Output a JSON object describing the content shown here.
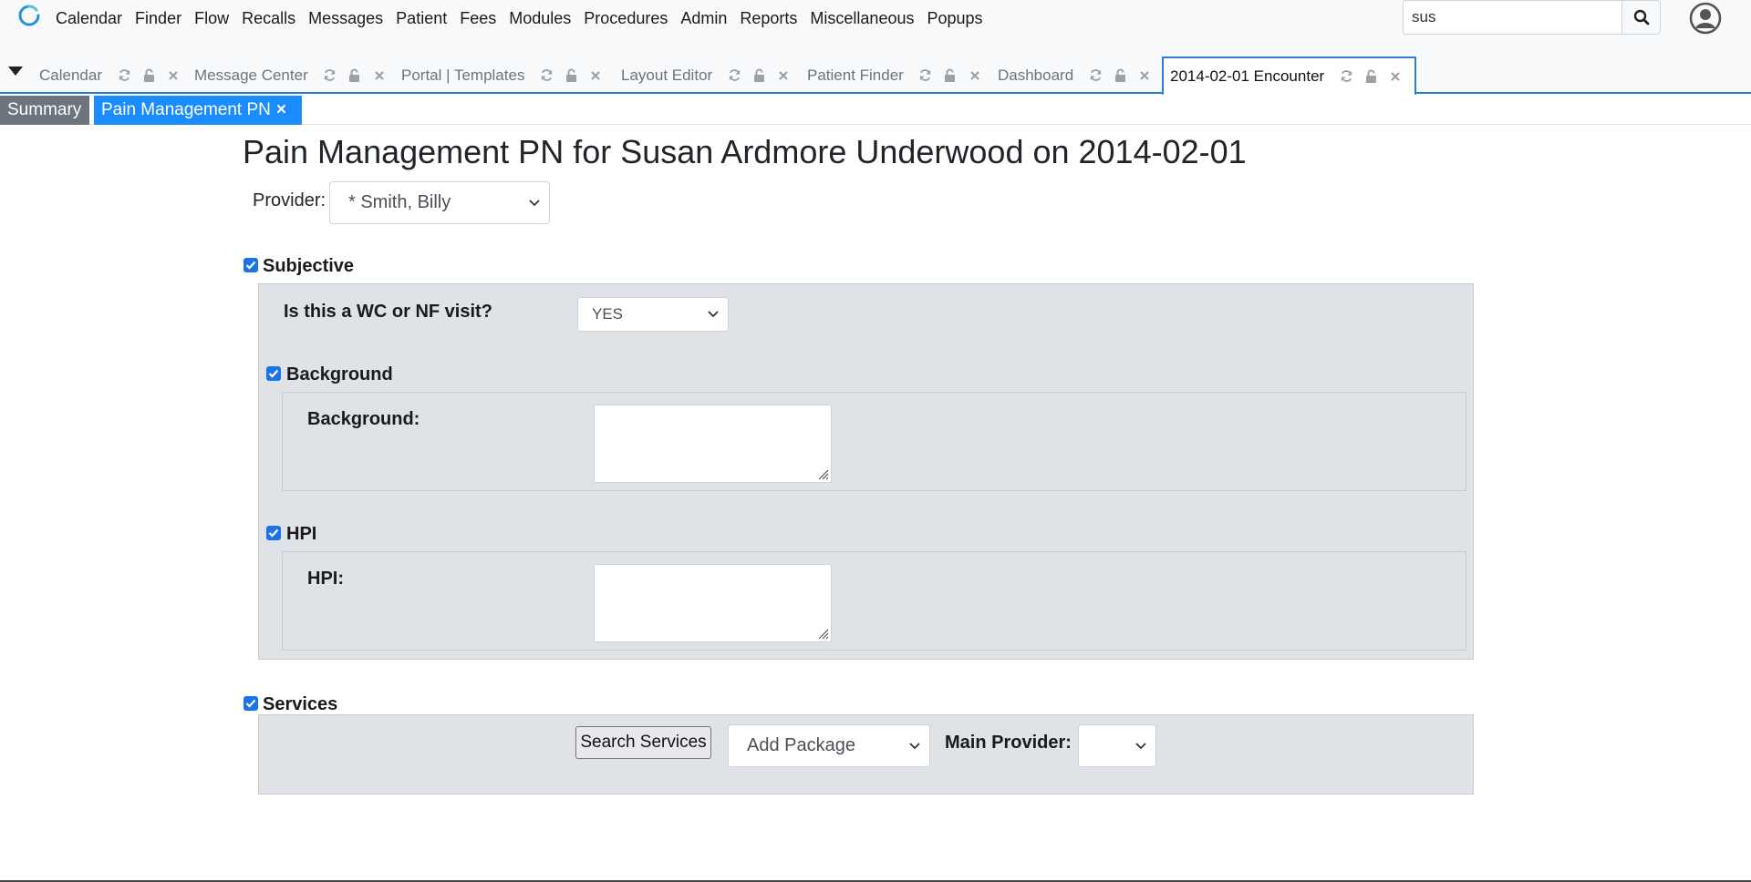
{
  "menu": {
    "items": [
      "Calendar",
      "Finder",
      "Flow",
      "Recalls",
      "Messages",
      "Patient",
      "Fees",
      "Modules",
      "Procedures",
      "Admin",
      "Reports",
      "Miscellaneous",
      "Popups"
    ]
  },
  "search": {
    "value": "sus"
  },
  "tabs": [
    {
      "label": "Calendar"
    },
    {
      "label": "Message Center"
    },
    {
      "label": "Portal | Templates"
    },
    {
      "label": "Layout Editor"
    },
    {
      "label": "Patient Finder"
    },
    {
      "label": "Dashboard"
    },
    {
      "label": "2014-02-01 Encounter",
      "active": true
    }
  ],
  "subtabs": {
    "summary": "Summary",
    "pain": "Pain Management PN",
    "close": "×"
  },
  "form": {
    "title": "Pain Management PN for Susan Ardmore Underwood on 2014-02-01",
    "provider_label": "Provider:",
    "provider_value": "* Smith, Billy",
    "subjective": {
      "label": "Subjective",
      "checked": true,
      "wc_question": "Is this a WC or NF visit?",
      "wc_value": "YES"
    },
    "background": {
      "label": "Background",
      "checked": true,
      "field_label": "Background:",
      "value": ""
    },
    "hpi": {
      "label": "HPI",
      "checked": true,
      "field_label": "HPI:",
      "value": ""
    },
    "services": {
      "label": "Services",
      "checked": true,
      "search_button": "Search Services",
      "package_select": "Add Package",
      "main_provider_label": "Main Provider:",
      "main_provider_value": ""
    }
  },
  "colors": {
    "accent": "#1a8cff",
    "checkbox": "#1a73e8",
    "panel": "#dfe2e6",
    "summary_tab": "#6c757d"
  }
}
